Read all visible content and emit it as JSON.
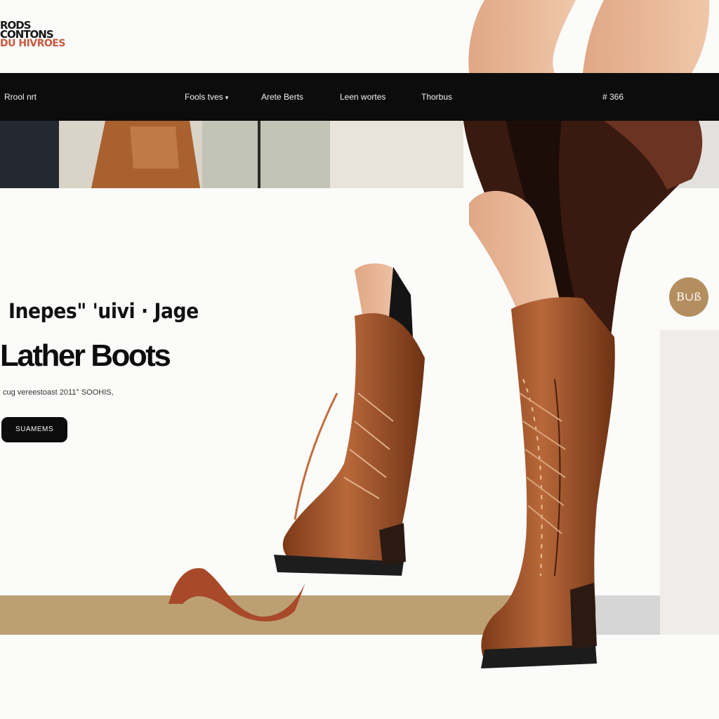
{
  "logo": {
    "line1": "RODS",
    "line2": "CONTONS",
    "line3": "DU HIVROES"
  },
  "nav": {
    "brand": "Rrool nrt",
    "items": [
      {
        "label": "Fools tves"
      },
      {
        "label": "Arete Berts"
      },
      {
        "label": "Leen wortes"
      },
      {
        "label": "Thorbus"
      }
    ],
    "extra": "# 366"
  },
  "hero": {
    "subtitle": "Inepes\" 'uivi · Jage",
    "title": "Lather Boots",
    "tagline": "cug vereestoast 2011° SOOHIS,",
    "cta_label": "SUAMEMS"
  },
  "badge": {
    "text": "Β∪ß"
  },
  "colors": {
    "nav_bg": "#0c0c0c",
    "leather": "#a85a2e",
    "band": "#bca074",
    "accent": "#c9583d",
    "badge": "#b48e5f"
  },
  "icons": {
    "caret": "chevron-down-icon"
  }
}
